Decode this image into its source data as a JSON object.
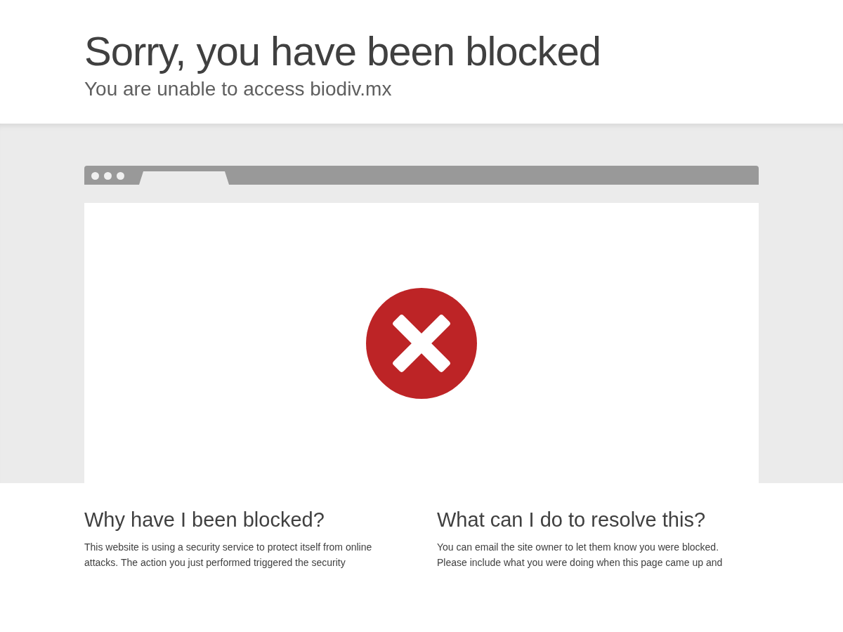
{
  "header": {
    "title": "Sorry, you have been blocked",
    "subtitle": "You are unable to access biodiv.mx"
  },
  "sections": [
    {
      "heading": "Why have I been blocked?",
      "lines": [
        "This website is using a security service to protect itself from online",
        "attacks. The action you just performed triggered the security"
      ]
    },
    {
      "heading": "What can I do to resolve this?",
      "lines": [
        "You can email the site owner to let them know you were blocked.",
        "Please include what you were doing when this page came up and"
      ]
    }
  ]
}
